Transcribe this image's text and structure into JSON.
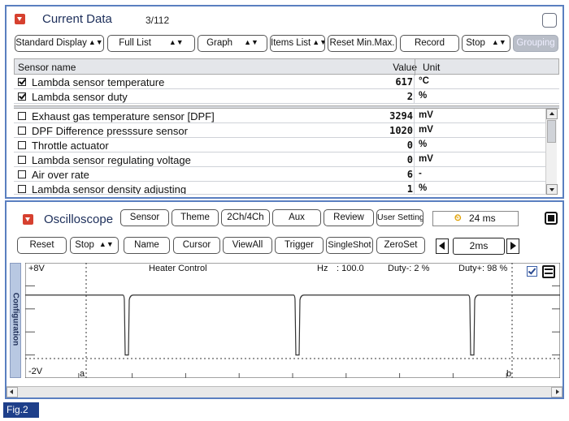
{
  "current_data": {
    "title": "Current Data",
    "counter": "3/112",
    "toolbar": {
      "standard_display": "Standard Display",
      "full_list": "Full List",
      "graph": "Graph",
      "items_list": "Items List",
      "reset_minmax": "Reset Min.Max.",
      "record": "Record",
      "stop": "Stop",
      "grouping": "Grouping"
    },
    "columns": {
      "name": "Sensor name",
      "value": "Value",
      "unit": "Unit"
    },
    "pinned_rows": [
      {
        "name": "Lambda sensor temperature",
        "value": "617",
        "unit": "°C",
        "checked": true
      },
      {
        "name": "Lambda sensor duty",
        "value": "2",
        "unit": "%",
        "checked": true
      }
    ],
    "rows": [
      {
        "name": "Exhaust gas temperature sensor [DPF]",
        "value": "3294",
        "unit": "mV",
        "checked": false
      },
      {
        "name": "DPF Difference presssure sensor",
        "value": "1020",
        "unit": "mV",
        "checked": false
      },
      {
        "name": "Throttle actuator",
        "value": "0",
        "unit": "%",
        "checked": false
      },
      {
        "name": "Lambda sensor regulating voltage",
        "value": "0",
        "unit": "mV",
        "checked": false
      },
      {
        "name": "Air over rate",
        "value": "6",
        "unit": "-",
        "checked": false
      },
      {
        "name": "Lambda sensor density adjusting",
        "value": "1",
        "unit": "%",
        "checked": false
      }
    ]
  },
  "oscilloscope": {
    "title": "Oscilloscope",
    "top_buttons": {
      "sensor": "Sensor",
      "theme": "Theme",
      "channels": "2Ch/4Ch",
      "aux": "Aux",
      "review": "Review",
      "user_setting": "User Setting"
    },
    "time_display": "24 ms",
    "second_buttons": {
      "reset": "Reset",
      "stop": "Stop",
      "name": "Name",
      "cursor": "Cursor",
      "viewall": "ViewAll",
      "trigger": "Trigger",
      "singleshot": "SingleShot",
      "zeroset": "ZeroSet"
    },
    "time_div": "2ms",
    "config_label": "Configuration",
    "plot": {
      "ymax_label": "+8V",
      "ymin_label": "-2V",
      "channel_name": "Heater Control",
      "hz_label": "Hz",
      "hz_value": ": 100.0",
      "duty_minus": "Duty-: 2 %",
      "duty_plus": "Duty+: 98 %",
      "cursor_a": "a",
      "cursor_b": "b"
    },
    "chart_data": {
      "type": "line",
      "title": "Heater Control",
      "ylim": [
        -2,
        8
      ],
      "frequency_hz": 100.0,
      "duty_minus_percent": 2,
      "duty_plus_percent": 98,
      "waveform": "square pulse, high level with brief low pulses (~2% duty low)"
    }
  },
  "figure_label": "Fig.2",
  "colors": {
    "panel_border": "#5a7fc0",
    "title": "#1c2e5a",
    "icon_red": "#d6402f",
    "fig_label_bg": "#1e3f8a",
    "config_bar": "#b8c8e2"
  }
}
